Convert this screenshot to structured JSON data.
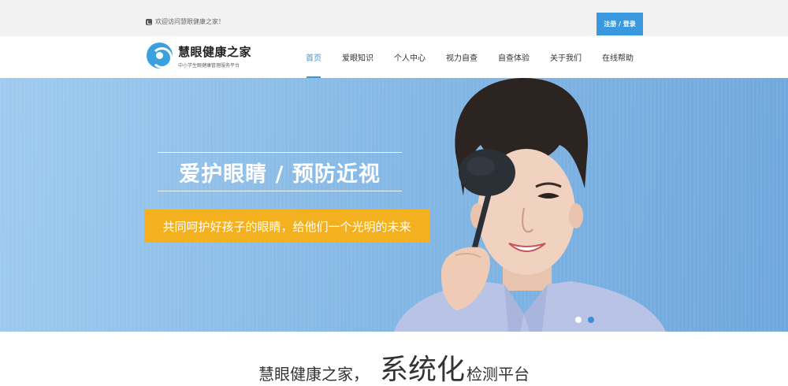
{
  "topbar": {
    "welcome_text": "欢迎访问慧眼健康之家！",
    "login_label": "注册 / 登录"
  },
  "logo": {
    "name": "慧眼健康之家",
    "subtitle": "中小学生眼健康管理服务平台"
  },
  "nav": {
    "items": [
      {
        "label": "首页",
        "active": true
      },
      {
        "label": "爱眼知识"
      },
      {
        "label": "个人中心"
      },
      {
        "label": "视力自查"
      },
      {
        "label": "自查体验"
      },
      {
        "label": "关于我们"
      },
      {
        "label": "在线帮助"
      }
    ]
  },
  "banner": {
    "headline": "爱护眼睛 / 预防近视",
    "tagline": "共同呵护好孩子的眼睛，给他们一个光明的未来",
    "slide_count": 2,
    "active_slide": 2
  },
  "section": {
    "part_a": "慧眼健康之家，",
    "part_b": "系统化",
    "part_c": "检测平台"
  },
  "colors": {
    "accent": "#3a99de",
    "tagline_bg": "#f4b11f",
    "topbar_bg": "#f2f2f2"
  }
}
